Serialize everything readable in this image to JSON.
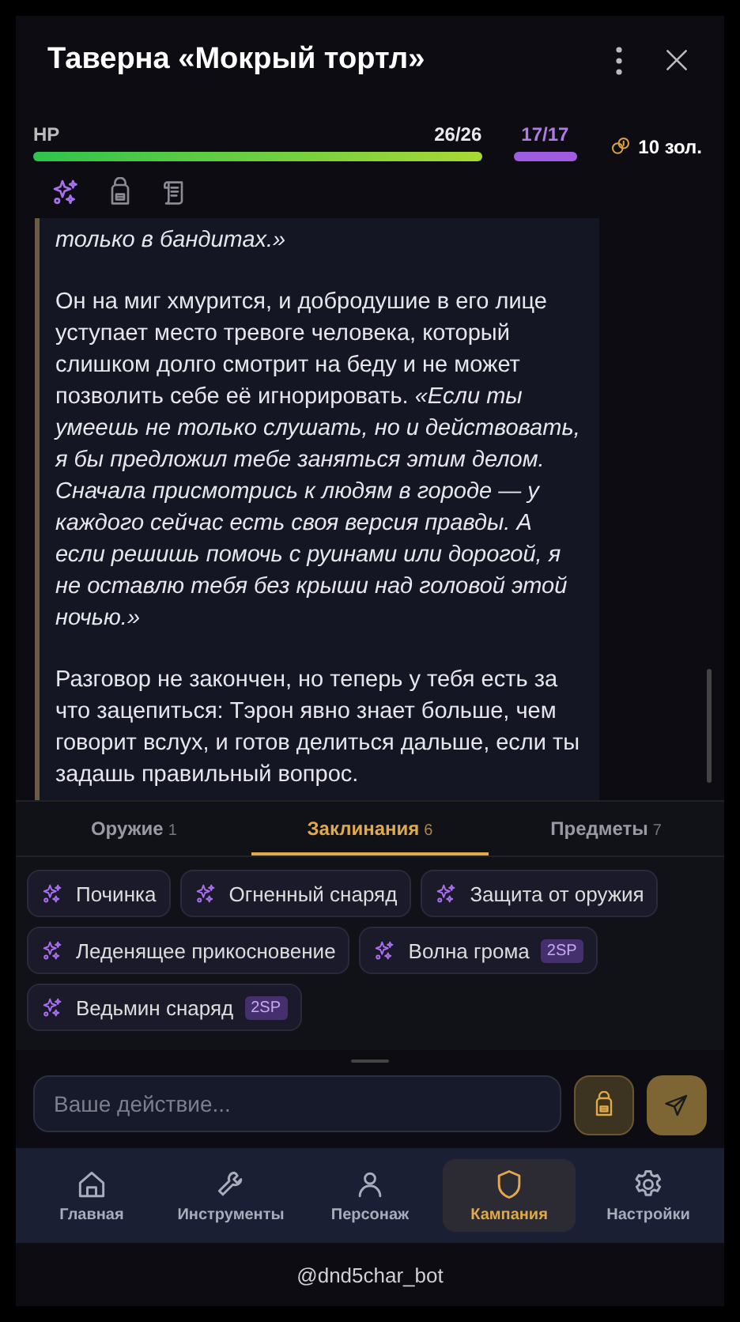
{
  "header": {
    "title": "Таверна «Мокрый тортл»"
  },
  "stats": {
    "hp": {
      "label": "HP",
      "value": "26/26",
      "level": 1
    },
    "mana": {
      "value": "17/17",
      "level": 1
    },
    "gold": "10 зол."
  },
  "quick_tabs": [
    {
      "kind": "spells",
      "selected": true
    },
    {
      "kind": "bag",
      "selected": false
    },
    {
      "kind": "scroll",
      "selected": false
    }
  ],
  "story": {
    "paragraphs": [
      "*только в бандитах.»*",
      "Он на миг хмурится, и добродушие в его лице уступает место тревоге человека, который слишком долго смотрит на беду и не может позволить себе её игнорировать. *«Если ты умеешь не только слушать, но и действовать, я бы предложил тебе заняться этим делом. Сначала присмотрись к людям в городе — у каждого сейчас есть своя версия правды. А если решишь помочь с руинами или дорогой, я не оставлю тебя без крыши над головой этой ночью.»*",
      "Разговор не закончен, но теперь у тебя есть за что зацепиться: Тэрон явно знает больше, чем говорит вслух, и готов делиться дальше, если ты задашь правильный вопрос."
    ]
  },
  "inventory_tabs": [
    {
      "label": "Оружие",
      "count": "1",
      "selected": false
    },
    {
      "label": "Заклинания",
      "count": "6",
      "selected": true
    },
    {
      "label": "Предметы",
      "count": "7",
      "selected": false
    }
  ],
  "spells": [
    {
      "name": "Починка"
    },
    {
      "name": "Огненный снаряд"
    },
    {
      "name": "Защита от оружия"
    },
    {
      "name": "Леденящее прикосновение"
    },
    {
      "name": "Волна грома",
      "cost": "2SP"
    },
    {
      "name": "Ведьмин снаряд",
      "cost": "2SP"
    }
  ],
  "action_input": {
    "placeholder": "Ваше действие..."
  },
  "nav": [
    {
      "kind": "home",
      "label": "Главная",
      "selected": false
    },
    {
      "kind": "tools",
      "label": "Инструменты",
      "selected": false
    },
    {
      "kind": "person",
      "label": "Персонаж",
      "selected": false
    },
    {
      "kind": "shield",
      "label": "Кампания",
      "selected": true
    },
    {
      "kind": "gear",
      "label": "Настройки",
      "selected": false
    }
  ],
  "footer": "@dnd5char_bot"
}
